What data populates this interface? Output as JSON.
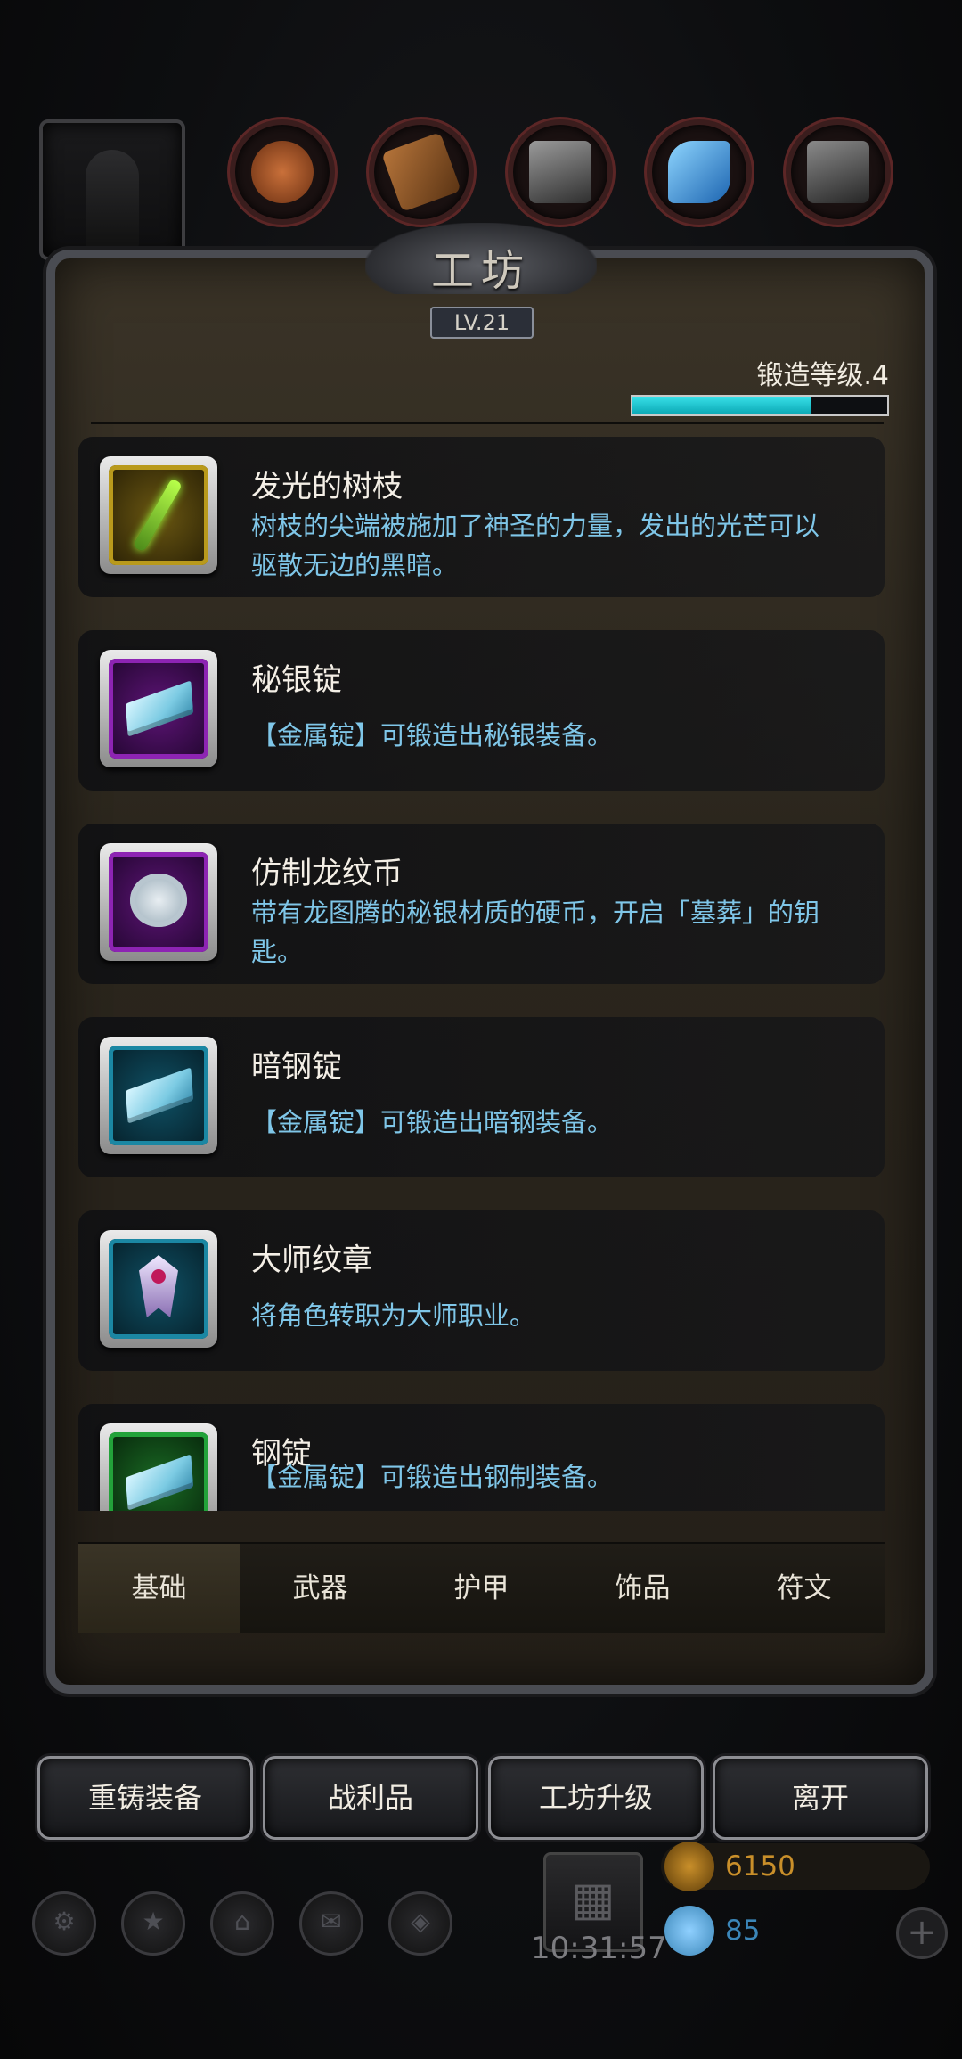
{
  "header": {
    "title": "工坊",
    "level": "LV.21",
    "forge_label": "锻造等级.4",
    "forge_progress": 0.7
  },
  "materials": [
    {
      "icon": "copper-ore-icon",
      "color": "#b0582a"
    },
    {
      "icon": "wood-plank-icon",
      "color": "#9a5f2a"
    },
    {
      "icon": "iron-plate-icon",
      "color": "#6e6e6e"
    },
    {
      "icon": "blue-crystal-icon",
      "color": "#2e8fd8"
    },
    {
      "icon": "steel-plate-icon",
      "color": "#5d5d5d"
    }
  ],
  "items": [
    {
      "name": "发光的树枝",
      "desc": "树枝的尖端被施加了神圣的力量，发出的光芒可以驱散无边的黑暗。",
      "rarity": "gold",
      "icon": "glowing-branch-icon"
    },
    {
      "name": "秘银锭",
      "desc": "【金属锭】可锻造出秘银装备。",
      "rarity": "purple",
      "icon": "mithril-ingot-icon"
    },
    {
      "name": "仿制龙纹币",
      "desc": "带有龙图腾的秘银材质的硬币，开启「墓葬」的钥匙。",
      "rarity": "purple",
      "icon": "dragon-coin-icon"
    },
    {
      "name": "暗钢锭",
      "desc": "【金属锭】可锻造出暗钢装备。",
      "rarity": "cyan",
      "icon": "dark-steel-ingot-icon"
    },
    {
      "name": "大师纹章",
      "desc": "将角色转职为大师职业。",
      "rarity": "cyan",
      "icon": "master-crest-icon"
    },
    {
      "name": "钢锭",
      "desc": "【金属锭】可锻造出钢制装备。",
      "rarity": "green",
      "icon": "steel-ingot-icon"
    }
  ],
  "tabs": [
    "基础",
    "武器",
    "护甲",
    "饰品",
    "符文"
  ],
  "actions": [
    "重铸装备",
    "战利品",
    "工坊升级",
    "离开"
  ],
  "hud": {
    "time": "10:31:57",
    "gold": "6150",
    "gems": "85",
    "gold_color": "#c98f2a",
    "gem_color": "#3b86b8"
  }
}
